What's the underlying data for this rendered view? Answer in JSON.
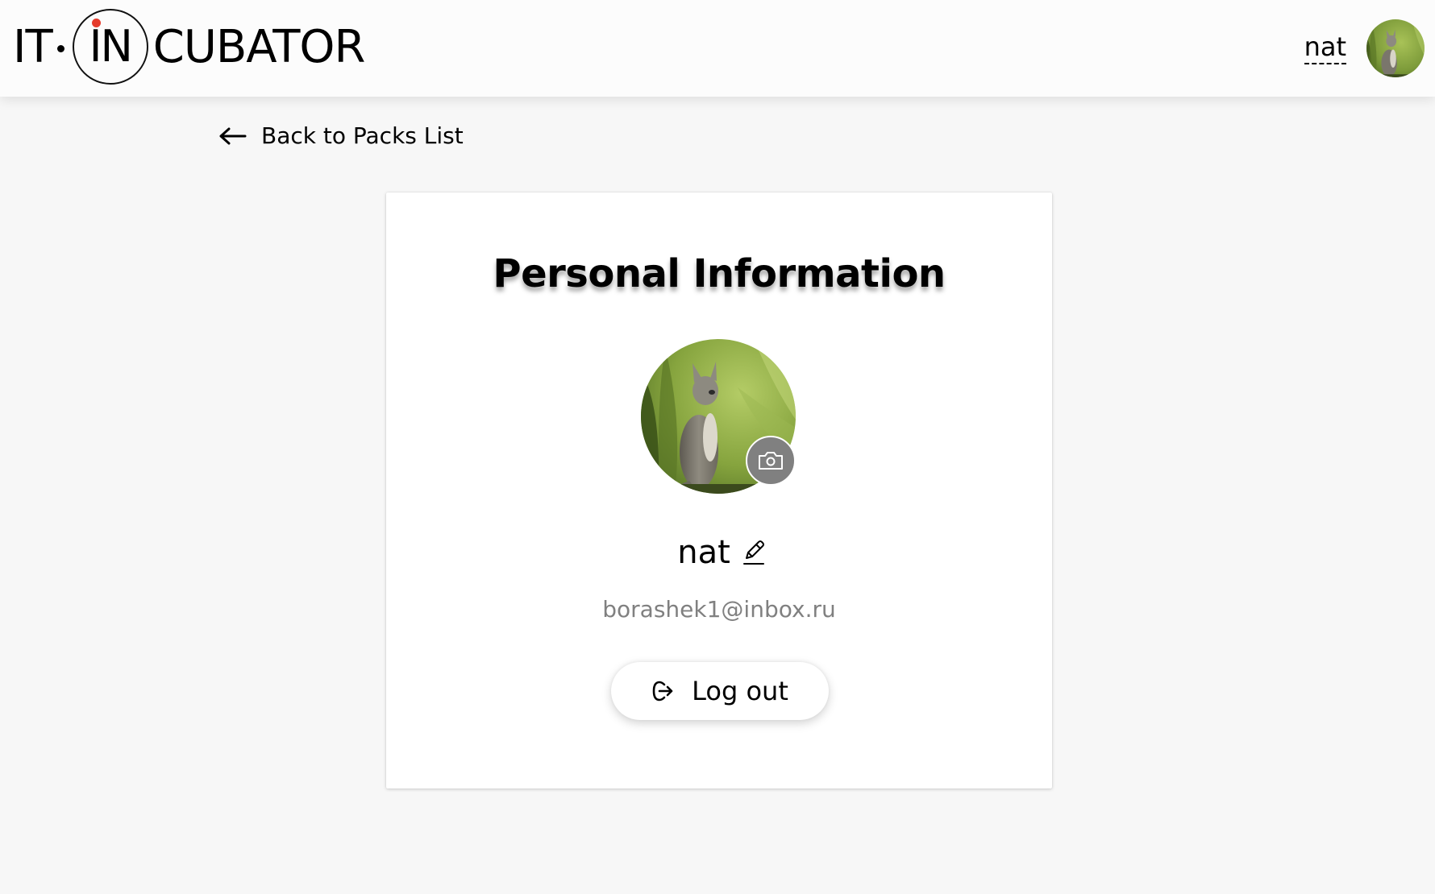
{
  "header": {
    "logo": {
      "part_it": "IT",
      "part_in": "IN",
      "part_cubator": "CUBATOR"
    },
    "user_name": "nat",
    "avatar_icon": "cat-avatar-icon"
  },
  "navigation": {
    "back_label": "Back to Packs List",
    "back_icon": "arrow-left-icon"
  },
  "profile": {
    "title": "Personal Information",
    "name": "nat",
    "email": "borashek1@inbox.ru",
    "camera_icon": "camera-icon",
    "edit_icon": "pencil-icon",
    "logout_label": "Log out",
    "logout_icon": "logout-icon"
  },
  "colors": {
    "background": "#f7f7f7",
    "header": "#fcfcfc",
    "card": "#ffffff",
    "muted_text": "#808080",
    "logo_accent": "#e53b2c",
    "camera_button": "#808080"
  }
}
